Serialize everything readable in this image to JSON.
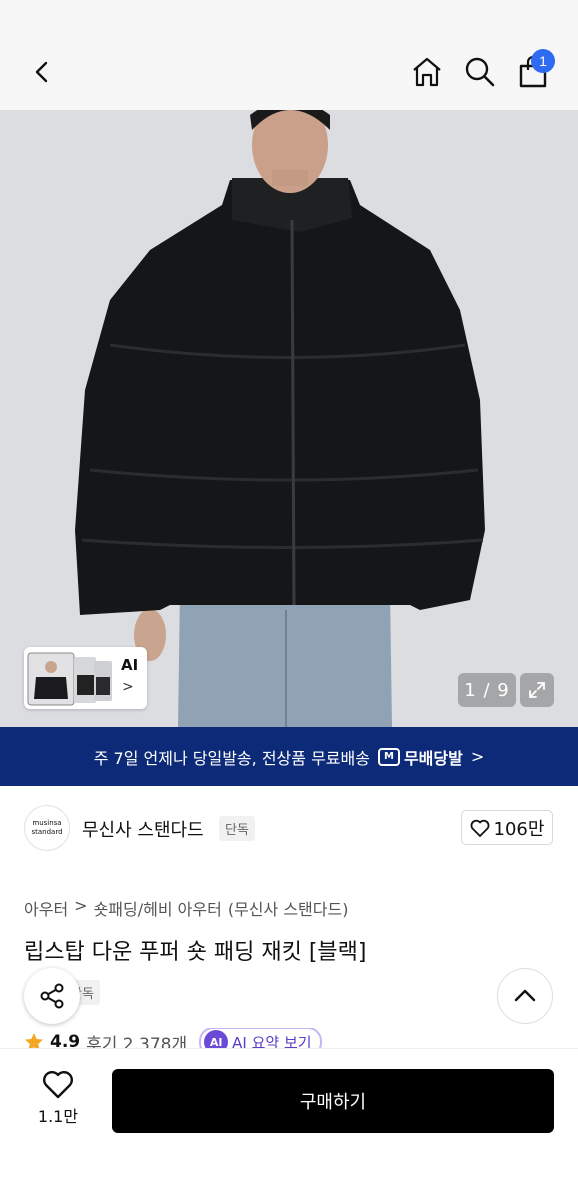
{
  "header": {
    "cart_badge": "1",
    "icons": [
      "chevron-left-icon",
      "home-icon",
      "search-icon",
      "shopping-bag-icon"
    ]
  },
  "gallery": {
    "ai_label": "AI",
    "ai_chevron": ">",
    "page_counter": "1 / 9"
  },
  "banner": {
    "text": "주 7일 언제나 당일발송, 전상품 무료배송",
    "logo_box": "M",
    "logo_text": "무배당발",
    "chevron": ">"
  },
  "brand": {
    "logo_line1": "musinsa",
    "logo_line2": "standard",
    "name": "무신사 스탠다드",
    "tag": "단독",
    "likes": "106만"
  },
  "product": {
    "breadcrumb": [
      "아우터",
      ">",
      "숏패딩/헤비 아우터",
      "(무신사 스탠다드)"
    ],
    "title": "립스탑 다운 푸퍼 숏 패딩 재킷 [블랙]",
    "exclusive_tag": "단독",
    "rating": "4.9",
    "reviews": "후기 2,378개",
    "ai_badge": "AI",
    "ai_summary_label": "AI 요약 보기"
  },
  "bottom": {
    "wish_count": "1.1만",
    "buy_label": "구매하기"
  },
  "colors": {
    "banner_bg": "#0d2a78",
    "badge_blue": "#2e6bf2",
    "ai_purple": "#6a4ad6",
    "star": "#f5a623"
  }
}
